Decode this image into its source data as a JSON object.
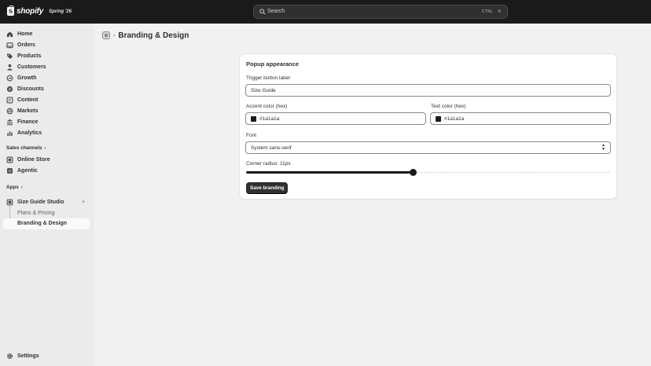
{
  "topbar": {
    "brand": "shopify",
    "edition": "Spring '26",
    "search": {
      "placeholder": "Search",
      "shortcut_mod": "CTRL",
      "shortcut_key": "K"
    }
  },
  "sidebar": {
    "items": [
      {
        "label": "Home",
        "icon": "home-icon"
      },
      {
        "label": "Orders",
        "icon": "inbox-icon"
      },
      {
        "label": "Products",
        "icon": "tag-icon"
      },
      {
        "label": "Customers",
        "icon": "person-icon"
      },
      {
        "label": "Growth",
        "icon": "growth-icon"
      },
      {
        "label": "Discounts",
        "icon": "discount-icon"
      },
      {
        "label": "Content",
        "icon": "content-icon"
      },
      {
        "label": "Markets",
        "icon": "globe-icon"
      },
      {
        "label": "Finance",
        "icon": "bank-icon"
      },
      {
        "label": "Analytics",
        "icon": "chart-icon"
      }
    ],
    "sales_channels": {
      "title": "Sales channels",
      "items": [
        {
          "label": "Online Store",
          "icon": "store-icon"
        },
        {
          "label": "Agentic",
          "icon": "agentic-icon"
        }
      ]
    },
    "apps": {
      "title": "Apps",
      "app": {
        "label": "Size Guide Studio",
        "icon": "app-icon"
      },
      "sub_items": [
        {
          "label": "Plans & Pricing"
        },
        {
          "label": "Branding & Design"
        }
      ]
    },
    "settings": {
      "label": "Settings",
      "icon": "gear-icon"
    }
  },
  "page": {
    "title": "Branding & Design"
  },
  "card": {
    "title": "Popup appearance",
    "trigger": {
      "label": "Trigger button label",
      "value": "Size Guide"
    },
    "accent": {
      "label": "Accent color (hex)",
      "value": "#1a1a1a"
    },
    "text_color": {
      "label": "Text color (hex)",
      "value": "#1a1a1a"
    },
    "font": {
      "label": "Font",
      "value": "System sans-serif"
    },
    "radius": {
      "label": "Corner radius: 11px",
      "value": 11,
      "fraction": 0.46
    },
    "save_label": "Save branding"
  },
  "colors": {
    "topbar": "#1a1a1a",
    "accent": "#1a1a1a",
    "sidebar": "#ebebeb",
    "background": "#f1f1f1"
  }
}
